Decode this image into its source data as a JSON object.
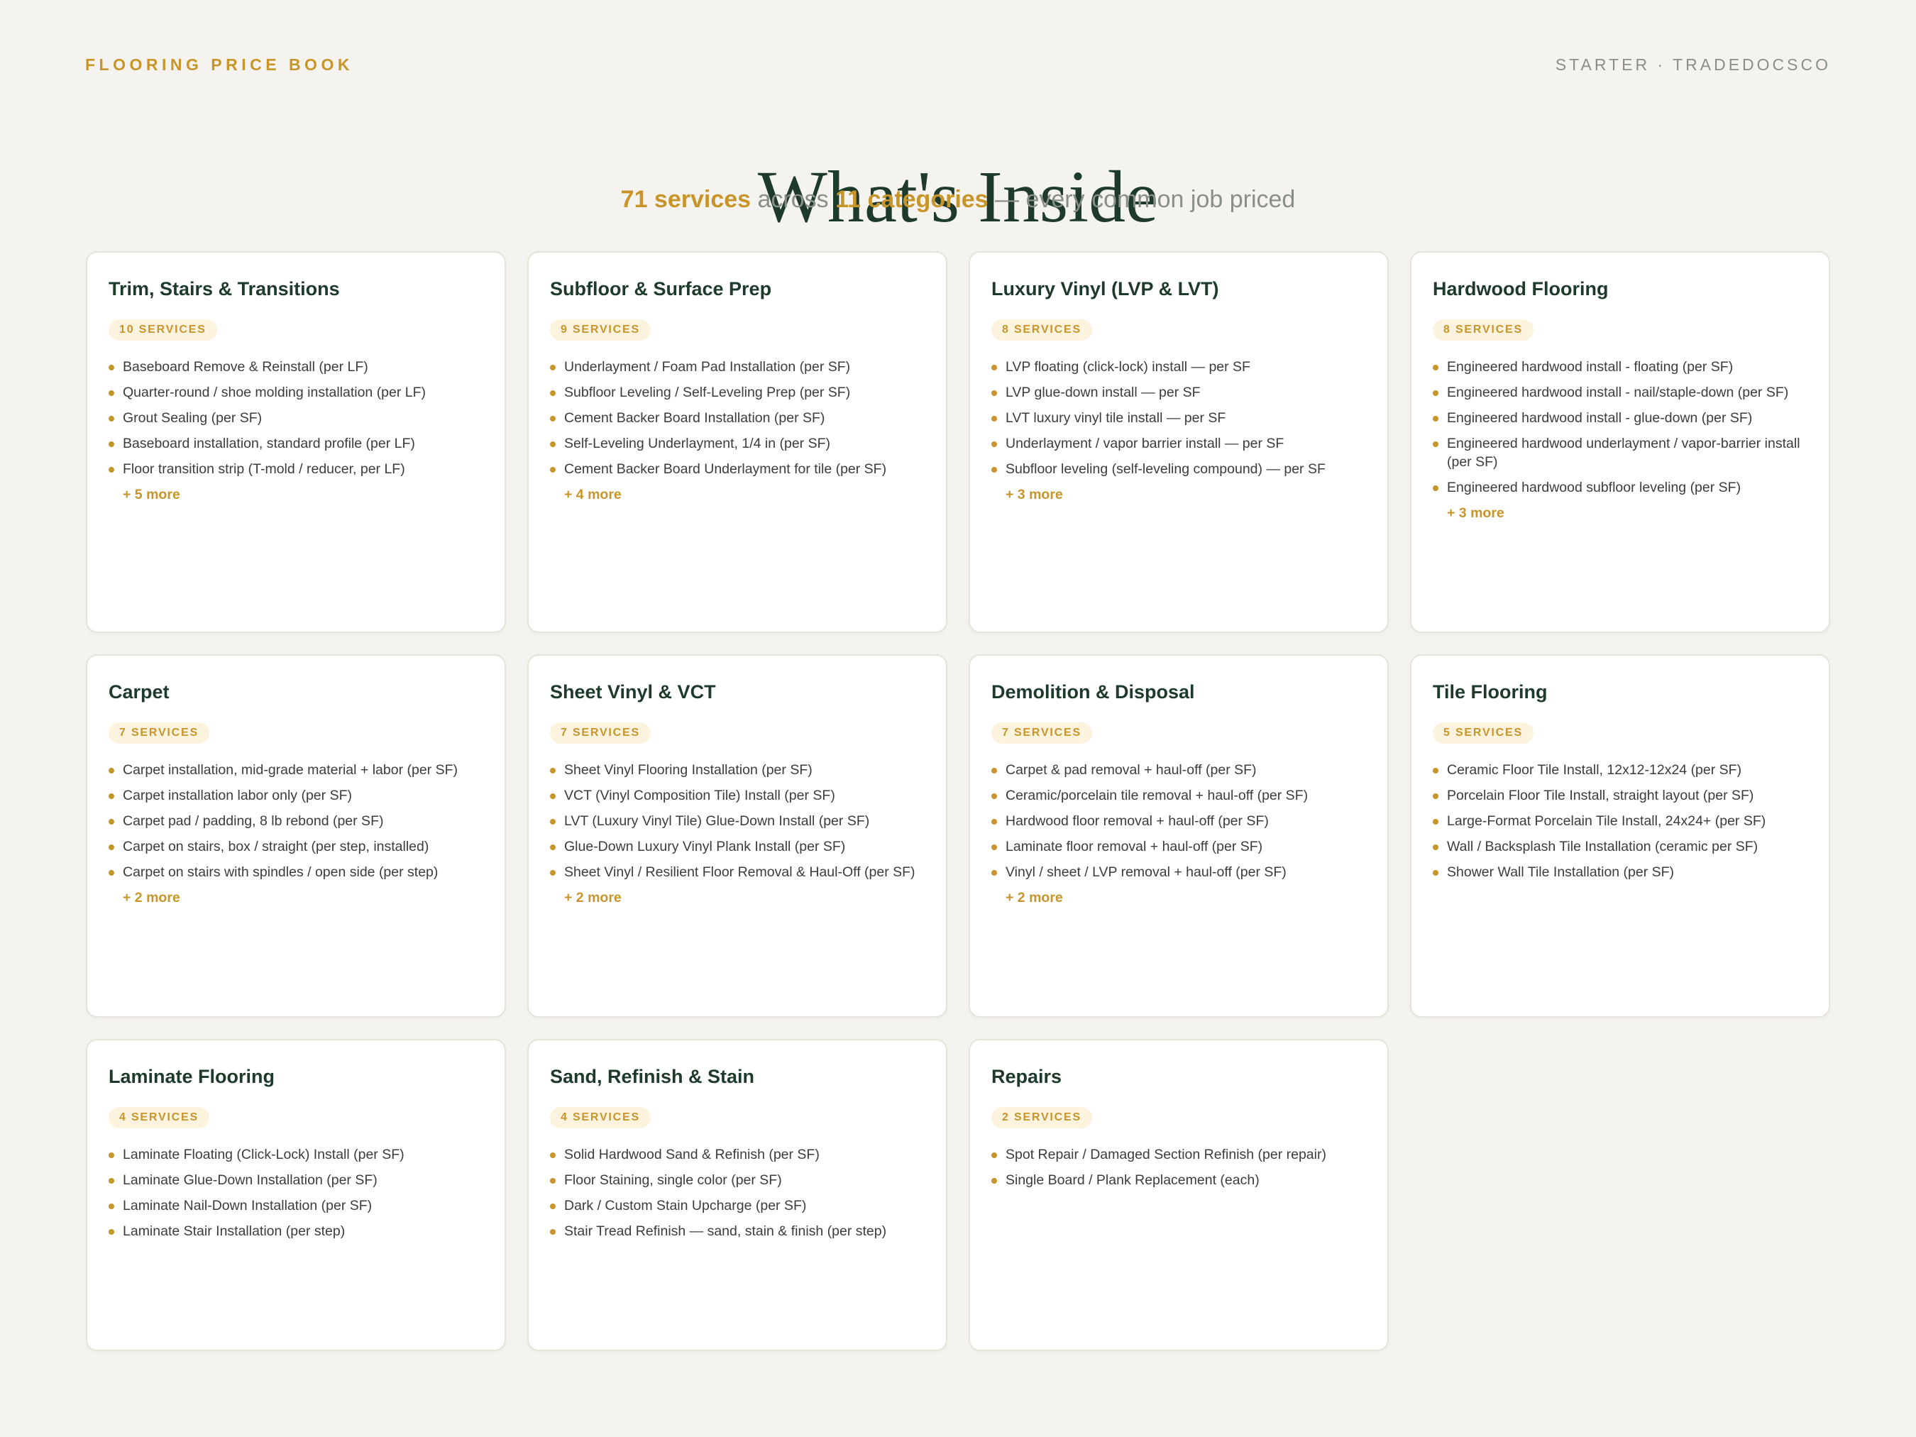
{
  "header": {
    "eyebrow": "FLOORING PRICE BOOK",
    "brand": "STARTER · TRADEDOCSCO",
    "title": "What's Inside",
    "subtitle": {
      "services": "71 services",
      "across": " across ",
      "categories": "11 categories",
      "tail": " — every common job priced"
    }
  },
  "accent_color": "#c8952b",
  "text_color": "#1d3a2a",
  "categories": [
    {
      "title": "Trim, Stairs & Transitions",
      "badge": "10 SERVICES",
      "items": [
        "Baseboard Remove & Reinstall (per LF)",
        "Quarter-round / shoe molding installation (per LF)",
        "Grout Sealing (per SF)",
        "Baseboard installation, standard profile (per LF)",
        "Floor transition strip (T-mold / reducer, per LF)"
      ],
      "more": "+ 5 more"
    },
    {
      "title": "Subfloor & Surface Prep",
      "badge": "9 SERVICES",
      "items": [
        "Underlayment / Foam Pad Installation (per SF)",
        "Subfloor Leveling / Self-Leveling Prep (per SF)",
        "Cement Backer Board Installation (per SF)",
        "Self-Leveling Underlayment, 1/4 in (per SF)",
        "Cement Backer Board Underlayment for tile (per SF)"
      ],
      "more": "+ 4 more"
    },
    {
      "title": "Luxury Vinyl (LVP & LVT)",
      "badge": "8 SERVICES",
      "items": [
        "LVP floating (click-lock) install — per SF",
        "LVP glue-down install — per SF",
        "LVT luxury vinyl tile install — per SF",
        "Underlayment / vapor barrier install — per SF",
        "Subfloor leveling (self-leveling compound) — per SF"
      ],
      "more": "+ 3 more"
    },
    {
      "title": "Hardwood Flooring",
      "badge": "8 SERVICES",
      "items": [
        "Engineered hardwood install - floating (per SF)",
        "Engineered hardwood install - nail/staple-down (per SF)",
        "Engineered hardwood install - glue-down (per SF)",
        "Engineered hardwood underlayment / vapor-barrier install (per SF)",
        "Engineered hardwood subfloor leveling (per SF)"
      ],
      "more": "+ 3 more"
    },
    {
      "title": "Carpet",
      "badge": "7 SERVICES",
      "items": [
        "Carpet installation, mid-grade material + labor (per SF)",
        "Carpet installation labor only (per SF)",
        "Carpet pad / padding, 8 lb rebond (per SF)",
        "Carpet on stairs, box / straight (per step, installed)",
        "Carpet on stairs with spindles / open side (per step)"
      ],
      "more": "+ 2 more"
    },
    {
      "title": "Sheet Vinyl & VCT",
      "badge": "7 SERVICES",
      "items": [
        "Sheet Vinyl Flooring Installation (per SF)",
        "VCT (Vinyl Composition Tile) Install (per SF)",
        "LVT (Luxury Vinyl Tile) Glue-Down Install (per SF)",
        "Glue-Down Luxury Vinyl Plank Install (per SF)",
        "Sheet Vinyl / Resilient Floor Removal & Haul-Off (per SF)"
      ],
      "more": "+ 2 more"
    },
    {
      "title": "Demolition & Disposal",
      "badge": "7 SERVICES",
      "items": [
        "Carpet & pad removal + haul-off (per SF)",
        "Ceramic/porcelain tile removal + haul-off (per SF)",
        "Hardwood floor removal + haul-off (per SF)",
        "Laminate floor removal + haul-off (per SF)",
        "Vinyl / sheet / LVP removal + haul-off (per SF)"
      ],
      "more": "+ 2 more"
    },
    {
      "title": "Tile Flooring",
      "badge": "5 SERVICES",
      "items": [
        "Ceramic Floor Tile Install, 12x12-12x24 (per SF)",
        "Porcelain Floor Tile Install, straight layout (per SF)",
        "Large-Format Porcelain Tile Install, 24x24+ (per SF)",
        "Wall / Backsplash Tile Installation (ceramic per SF)",
        "Shower Wall Tile Installation (per SF)"
      ],
      "more": ""
    },
    {
      "title": "Laminate Flooring",
      "badge": "4 SERVICES",
      "items": [
        "Laminate Floating (Click-Lock) Install (per SF)",
        "Laminate Glue-Down Installation (per SF)",
        "Laminate Nail-Down Installation (per SF)",
        "Laminate Stair Installation (per step)"
      ],
      "more": ""
    },
    {
      "title": "Sand, Refinish & Stain",
      "badge": "4 SERVICES",
      "items": [
        "Solid Hardwood Sand & Refinish (per SF)",
        "Floor Staining, single color (per SF)",
        "Dark / Custom Stain Upcharge (per SF)",
        "Stair Tread Refinish — sand, stain & finish (per step)"
      ],
      "more": ""
    },
    {
      "title": "Repairs",
      "badge": "2 SERVICES",
      "items": [
        "Spot Repair / Damaged Section Refinish (per repair)",
        "Single Board / Plank Replacement (each)"
      ],
      "more": ""
    }
  ]
}
